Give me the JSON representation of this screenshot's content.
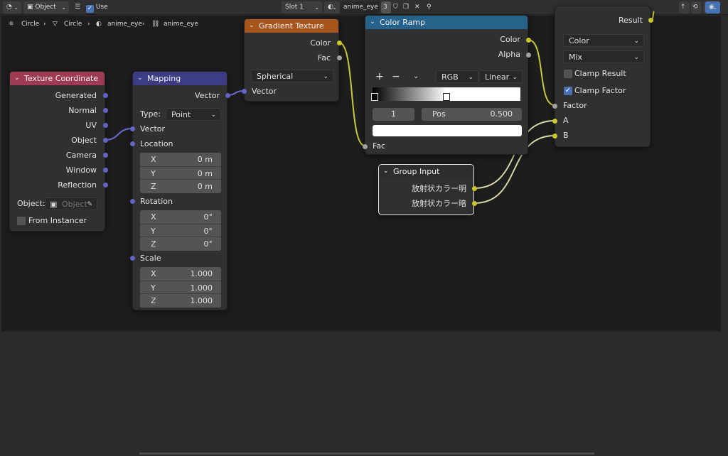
{
  "header": {
    "object_mode": "Object",
    "use_nodes": "Use Nodes",
    "slot": "Slot 1",
    "material": "anime_eye",
    "users": "3"
  },
  "breadcrumb": [
    "Circle",
    "Circle",
    "anime_eye",
    "anime_eye"
  ],
  "nodes": {
    "texcoord": {
      "title": "Texture Coordinate",
      "outputs": [
        "Generated",
        "Normal",
        "UV",
        "Object",
        "Camera",
        "Window",
        "Reflection"
      ],
      "object_label": "Object:",
      "object_placeholder": "Object",
      "from_instancer": "From Instancer"
    },
    "mapping": {
      "title": "Mapping",
      "out_vector": "Vector",
      "type_label": "Type:",
      "type_value": "Point",
      "in_vector": "Vector",
      "location": "Location",
      "location_xyz": [
        [
          "X",
          "0 m"
        ],
        [
          "Y",
          "0 m"
        ],
        [
          "Z",
          "0 m"
        ]
      ],
      "rotation": "Rotation",
      "rotation_xyz": [
        [
          "X",
          "0°"
        ],
        [
          "Y",
          "0°"
        ],
        [
          "Z",
          "0°"
        ]
      ],
      "scale": "Scale",
      "scale_xyz": [
        [
          "X",
          "1.000"
        ],
        [
          "Y",
          "1.000"
        ],
        [
          "Z",
          "1.000"
        ]
      ]
    },
    "gradient": {
      "title": "Gradient Texture",
      "out_color": "Color",
      "out_fac": "Fac",
      "type_value": "Spherical",
      "in_vector": "Vector"
    },
    "colorramp": {
      "title": "Color Ramp",
      "out_color": "Color",
      "out_alpha": "Alpha",
      "color_mode": "RGB",
      "interpolation": "Linear",
      "stop_index": "1",
      "pos_label": "Pos",
      "pos_value": "0.500",
      "in_fac": "Fac"
    },
    "group_input": {
      "title": "Group Input",
      "out1": "放射状カラー明",
      "out2": "放射状カラー暗"
    },
    "mix": {
      "out_result": "Result",
      "data_type": "Color",
      "blend_mode": "Mix",
      "clamp_result": "Clamp Result",
      "clamp_factor": "Clamp Factor",
      "in_factor": "Factor",
      "in_a": "A",
      "in_b": "B"
    }
  }
}
